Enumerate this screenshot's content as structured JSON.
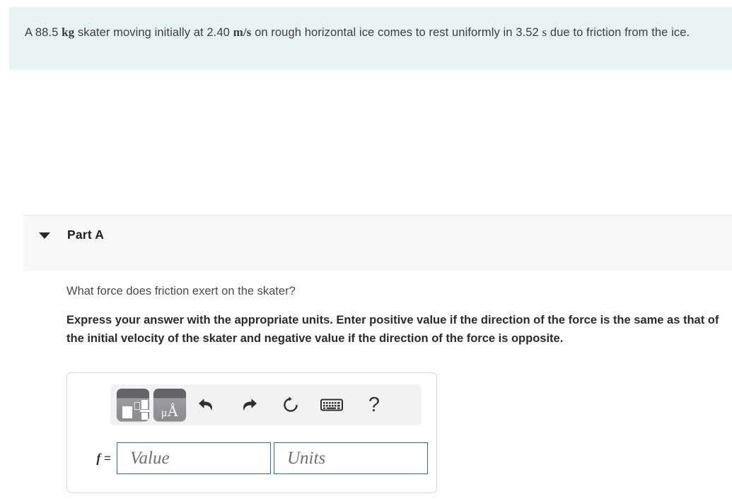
{
  "statement": {
    "segments": [
      {
        "t": "A ",
        "k": "plain"
      },
      {
        "t": "88.5",
        "k": "num"
      },
      {
        "t": " ",
        "k": "plain"
      },
      {
        "t": "kg",
        "k": "unit"
      },
      {
        "t": " skater moving initially at ",
        "k": "plain"
      },
      {
        "t": "2.40",
        "k": "num"
      },
      {
        "t": " ",
        "k": "plain"
      },
      {
        "t": "m/s",
        "k": "unit-frac"
      },
      {
        "t": " on rough horizontal ice comes to rest uniformly in ",
        "k": "plain"
      },
      {
        "t": "3.52",
        "k": "num"
      },
      {
        "t": " ",
        "k": "plain"
      },
      {
        "t": "s",
        "k": "unit-s"
      },
      {
        "t": " due to friction from the ice.",
        "k": "plain"
      }
    ],
    "full_text": "A 88.5 kg skater moving initially at 2.40 m/s on rough horizontal ice comes to rest uniformly in 3.52 s due to friction from the ice.",
    "background_color": "#e7f4f2"
  },
  "part": {
    "title": "Part A",
    "collapse_icon": "caret-down-icon",
    "band_color": "#f8f8f8"
  },
  "question": {
    "prompt": "What force does friction exert on the skater?",
    "instruction": "Express your answer with the appropriate units. Enter positive value if the direction of the force is the same as that of the initial velocity of the skater and negative value if the direction of the force is opposite."
  },
  "answer_widget": {
    "toolbar": {
      "buttons": [
        {
          "name": "math-templates-icon",
          "title": "Templates"
        },
        {
          "name": "units-icon",
          "title": "μÅ"
        },
        {
          "name": "undo-icon",
          "title": "Undo"
        },
        {
          "name": "redo-icon",
          "title": "Redo"
        },
        {
          "name": "reset-icon",
          "title": "Reset"
        },
        {
          "name": "keypad-icon",
          "title": "Keyboard shortcuts"
        },
        {
          "name": "help-icon",
          "title": "?"
        }
      ],
      "help_glyph": "?",
      "units_glyph_mu": "μ",
      "units_glyph_a": "Å",
      "background_color": "#f2f2f2"
    },
    "variable_label": "f",
    "equals_sign": "=",
    "value_field": {
      "value": "",
      "placeholder": "Value"
    },
    "units_field": {
      "value": "",
      "placeholder": "Units"
    },
    "border_color": "#2b7088"
  }
}
